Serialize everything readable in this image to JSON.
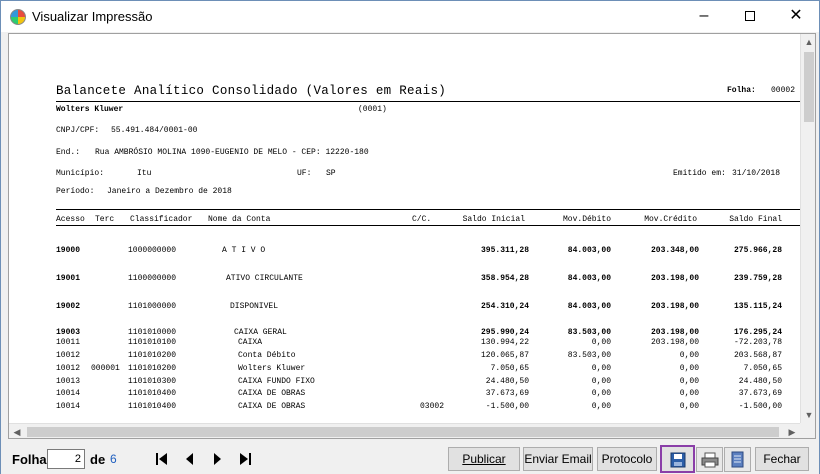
{
  "window": {
    "title": "Visualizar Impressão"
  },
  "report": {
    "title": "Balancete Analítico Consolidado (Valores em Reais)",
    "folha_label": "Folha:",
    "folha_value": "00002",
    "company": "Wolters Kluwer",
    "company_code": "(0001)",
    "cnpj_label": "CNPJ/CPF:",
    "cnpj_value": "55.491.484/0001-00",
    "end_label": "End.:",
    "end_value": "Rua AMBRÓSIO MOLINA 1090-EUGENIO DE MELO - CEP: 12220-180",
    "municipio_label": "Município:",
    "municipio_value": "Itu",
    "uf_label": "UF:",
    "uf_value": "SP",
    "emitido_label": "Emitido em:",
    "emitido_value": "31/10/2018",
    "periodo_label": "Período:",
    "periodo_value": "Janeiro a Dezembro de 2018",
    "columns": [
      "Acesso",
      "Terc",
      "Classificador",
      "Nome da Conta",
      "C/C.",
      "Saldo Inicial",
      "Mov.Débito",
      "Mov.Crédito",
      "Saldo Final"
    ],
    "rows": [
      {
        "acesso": "19000",
        "terc": "",
        "classificador": "1000000000",
        "nome": "A T I V O",
        "cc": "",
        "saldo_inicial": "395.311,28",
        "mov_debito": "84.003,00",
        "mov_credito": "203.348,00",
        "saldo_final": "275.966,28"
      },
      {
        "acesso": "19001",
        "terc": "",
        "classificador": "1100000000",
        "nome": "ATIVO CIRCULANTE",
        "cc": "",
        "saldo_inicial": "358.954,28",
        "mov_debito": "84.003,00",
        "mov_credito": "203.198,00",
        "saldo_final": "239.759,28"
      },
      {
        "acesso": "19002",
        "terc": "",
        "classificador": "1101000000",
        "nome": "DISPONIVEL",
        "cc": "",
        "saldo_inicial": "254.310,24",
        "mov_debito": "84.003,00",
        "mov_credito": "203.198,00",
        "saldo_final": "135.115,24"
      },
      {
        "acesso": "19003",
        "terc": "",
        "classificador": "1101010000",
        "nome": "CAIXA GERAL",
        "cc": "",
        "saldo_inicial": "295.990,24",
        "mov_debito": "83.503,00",
        "mov_credito": "203.198,00",
        "saldo_final": "176.295,24"
      },
      {
        "acesso": "10011",
        "terc": "",
        "classificador": "1101010100",
        "nome": "CAIXA",
        "cc": "",
        "saldo_inicial": "130.994,22",
        "mov_debito": "0,00",
        "mov_credito": "203.198,00",
        "saldo_final": "-72.203,78"
      },
      {
        "acesso": "10012",
        "terc": "",
        "classificador": "1101010200",
        "nome": "Conta Débito",
        "cc": "",
        "saldo_inicial": "120.065,87",
        "mov_debito": "83.503,00",
        "mov_credito": "0,00",
        "saldo_final": "203.568,87"
      },
      {
        "acesso": "10012",
        "terc": "000001",
        "classificador": "1101010200",
        "nome": "Wolters Kluwer",
        "cc": "",
        "saldo_inicial": "7.050,65",
        "mov_debito": "0,00",
        "mov_credito": "0,00",
        "saldo_final": "7.050,65"
      },
      {
        "acesso": "10013",
        "terc": "",
        "classificador": "1101010300",
        "nome": "CAIXA FUNDO FIXO",
        "cc": "",
        "saldo_inicial": "24.480,50",
        "mov_debito": "0,00",
        "mov_credito": "0,00",
        "saldo_final": "24.480,50"
      },
      {
        "acesso": "10014",
        "terc": "",
        "classificador": "1101010400",
        "nome": "CAIXA DE OBRAS",
        "cc": "",
        "saldo_inicial": "37.673,69",
        "mov_debito": "0,00",
        "mov_credito": "0,00",
        "saldo_final": "37.673,69"
      },
      {
        "acesso": "10014",
        "terc": "",
        "classificador": "1101010400",
        "nome": "CAIXA DE OBRAS",
        "cc": "03002",
        "saldo_inicial": "-1.500,00",
        "mov_debito": "0,00",
        "mov_credito": "0,00",
        "saldo_final": "-1.500,00"
      }
    ]
  },
  "toolbar": {
    "folha_label": "Folha",
    "page_value": "2",
    "de_label": "de",
    "total_pages": "6",
    "publicar_label": "Publicar",
    "enviar_email_label": "Enviar Email",
    "protocolo_label": "Protocolo",
    "fechar_label": "Fechar",
    "highlight_color": "#8a3ea8"
  }
}
